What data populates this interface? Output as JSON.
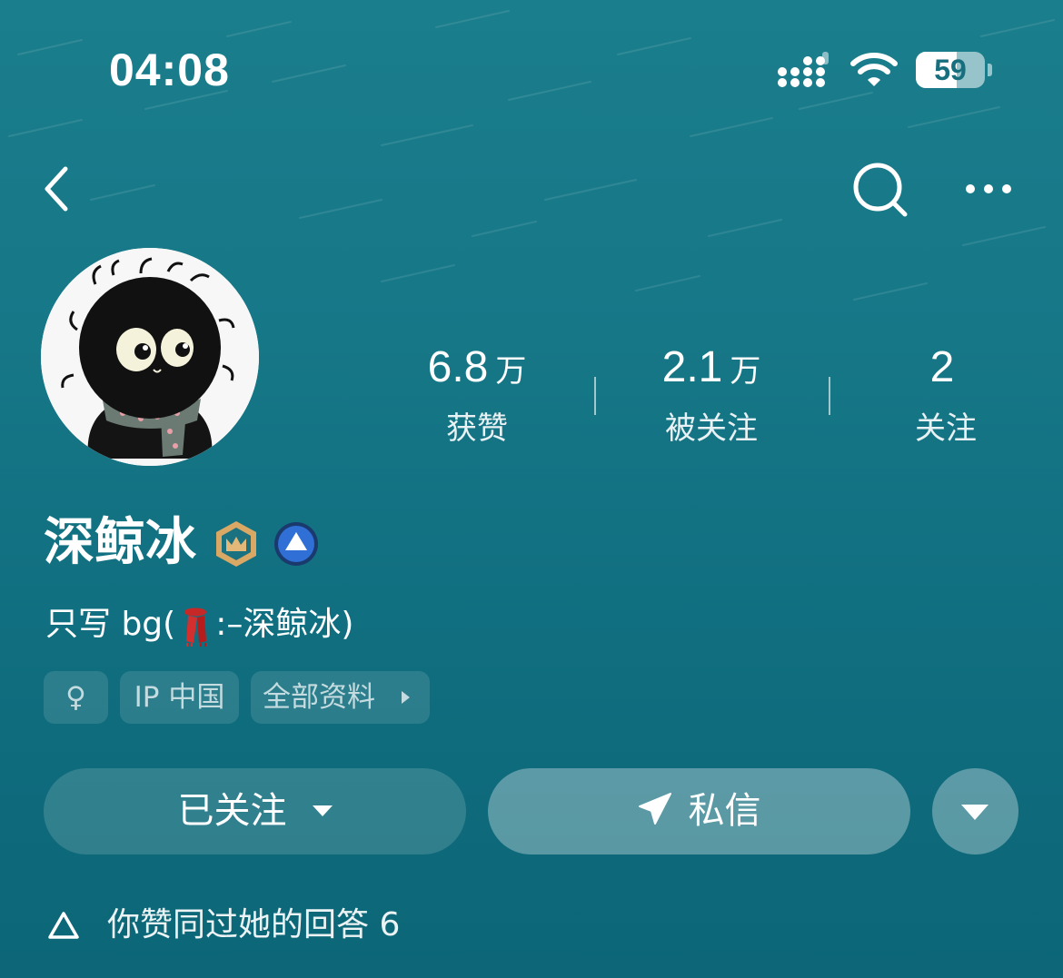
{
  "status_bar": {
    "time": "04:08",
    "battery": "59",
    "battery_level": 0.59
  },
  "nav": {
    "back_icon": "chevron-left-icon",
    "search_icon": "search-icon",
    "more_icon": "more-icon"
  },
  "profile": {
    "name": "深鲸冰",
    "badges": [
      "crown-badge-icon",
      "up-arrow-badge-icon"
    ],
    "bio_before": "只写 bg(",
    "bio_emoji": "scarf-emoji",
    "bio_after": ":–深鲸冰)"
  },
  "stats": [
    {
      "value": "6.8",
      "unit": "万",
      "label": "获赞"
    },
    {
      "value": "2.1",
      "unit": "万",
      "label": "被关注"
    },
    {
      "value": "2",
      "unit": "",
      "label": "关注"
    }
  ],
  "tags": {
    "gender_symbol": "♀",
    "ip": "IP 中国",
    "profile": "全部资料"
  },
  "actions": {
    "followed_label": "已关注",
    "message_label": "私信"
  },
  "footer": {
    "upvote_text": "你赞同过她的回答 6"
  },
  "colors": {
    "background_top": "#1b7e8c",
    "background_bottom": "#0c6677",
    "badge_gold": "#d9a865",
    "badge_blue": "#2f6fd6"
  }
}
